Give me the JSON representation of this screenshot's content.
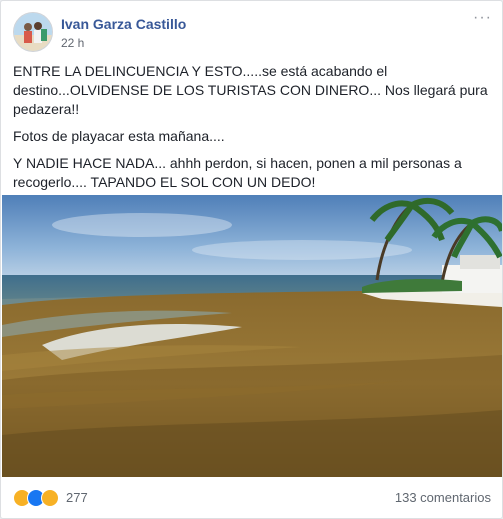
{
  "post": {
    "author": "Ivan Garza Castillo",
    "time": "22 h",
    "paragraphs": [
      "ENTRE LA DELINCUENCIA Y ESTO.....se está acabando el destino...OLVIDENSE DE LOS TURISTAS CON DINERO... Nos llegará pura pedazera!!",
      "Fotos de playacar esta mañana....",
      "Y NADIE HACE NADA... ahhh perdon, si hacen, ponen a mil personas a recogerlo.... TAPANDO EL SOL CON UN DEDO!"
    ],
    "more_icon": "ellipsis-icon",
    "more_label": "···"
  },
  "footer": {
    "reactions": [
      "sad-reaction-icon",
      "like-reaction-icon",
      "wow-reaction-icon"
    ],
    "reaction_count": "277",
    "comments": "133 comentarios"
  },
  "colors": {
    "author": "#385898",
    "like": "#1877f2",
    "sad_wow": "#f7b125"
  }
}
